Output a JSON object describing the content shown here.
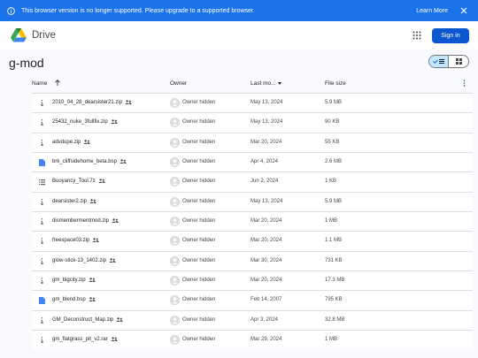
{
  "banner": {
    "message": "This browser version is no longer supported. Please upgrade to a supported browser.",
    "learn_more": "Learn More"
  },
  "topbar": {
    "app_name": "Drive",
    "signin_label": "Sign in"
  },
  "folder": {
    "title": "g-mod"
  },
  "table": {
    "headers": {
      "name": "Name",
      "owner": "Owner",
      "last_modified": "Last mo...",
      "file_size": "File size"
    },
    "rows": [
      {
        "name": "2010_04_28_dearsister21.zip",
        "owner": "Owner hidden",
        "date": "May 13, 2024",
        "size": "5.9 MB",
        "icon": "zip-icon"
      },
      {
        "name": "25432_nuke_3fullfix.zip",
        "owner": "Owner hidden",
        "date": "May 13, 2024",
        "size": "90 KB",
        "icon": "zip-icon"
      },
      {
        "name": "advdupe.zip",
        "owner": "Owner hidden",
        "date": "Mar 20, 2024",
        "size": "55 KB",
        "icon": "zip-icon"
      },
      {
        "name": "brk_cliffsidehome_beta.bsp",
        "owner": "Owner hidden",
        "date": "Apr 4, 2024",
        "size": "2.6 MB",
        "icon": "doc-icon"
      },
      {
        "name": "Buoyancy_Tool.7z",
        "owner": "Owner hidden",
        "date": "Jun 2, 2024",
        "size": "1 KB",
        "icon": "list-icon"
      },
      {
        "name": "dearsister2.zip",
        "owner": "Owner hidden",
        "date": "May 13, 2024",
        "size": "5.9 MB",
        "icon": "zip-icon"
      },
      {
        "name": "dismembermentmod.zip",
        "owner": "Owner hidden",
        "date": "Mar 20, 2024",
        "size": "1 MB",
        "icon": "zip-icon"
      },
      {
        "name": "freespace03.zip",
        "owner": "Owner hidden",
        "date": "Mar 20, 2024",
        "size": "1.1 MB",
        "icon": "zip-icon"
      },
      {
        "name": "glow-stick-13_1402.zip",
        "owner": "Owner hidden",
        "date": "Mar 30, 2024",
        "size": "731 KB",
        "icon": "zip-icon"
      },
      {
        "name": "gm_bigcity.zip",
        "owner": "Owner hidden",
        "date": "Mar 20, 2024",
        "size": "17.3 MB",
        "icon": "zip-icon"
      },
      {
        "name": "gm_blend.bsp",
        "owner": "Owner hidden",
        "date": "Feb 14, 2007",
        "size": "795 KB",
        "icon": "doc-icon"
      },
      {
        "name": "GM_Deconstruct_Map.zip",
        "owner": "Owner hidden",
        "date": "Apr 3, 2024",
        "size": "32.8 MB",
        "icon": "zip-icon"
      },
      {
        "name": "gm_flatgrass_pit_v2.rar",
        "owner": "Owner hidden",
        "date": "Mar 29, 2024",
        "size": "1 MB",
        "icon": "zip-icon"
      }
    ]
  },
  "colors": {
    "banner": "#1a73e8",
    "signin": "#0b57d0",
    "doc_icon": "#4285f4",
    "view_selected": "#c2e7ff"
  }
}
